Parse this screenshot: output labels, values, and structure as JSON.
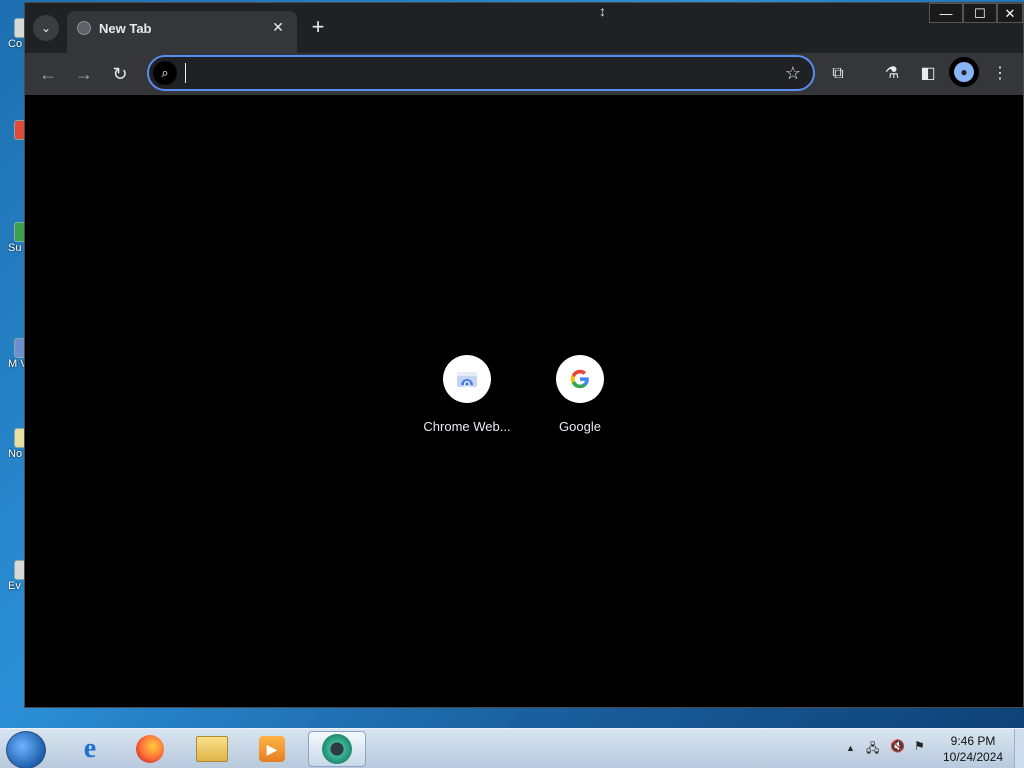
{
  "desktop": {
    "icons": [
      {
        "label": "Co"
      },
      {
        "label": ""
      },
      {
        "label": "Su"
      },
      {
        "label": "M Visu"
      },
      {
        "label": "No"
      },
      {
        "label": "Ev"
      }
    ]
  },
  "browser": {
    "tab": {
      "title": "New Tab",
      "close": "✕"
    },
    "new_tab": "+",
    "tab_search": "⌄",
    "window_controls": {
      "minimize": "—",
      "maximize": "☐",
      "close": "✕"
    },
    "omnibox": {
      "value": "",
      "placeholder": ""
    },
    "shortcuts": [
      {
        "name": "Chrome Web...",
        "icon": "chrome-web-store-icon"
      },
      {
        "name": "Google",
        "icon": "google-g-icon"
      }
    ]
  },
  "taskbar": {
    "apps": [
      {
        "icon": "internet-explorer-icon",
        "glyph": "e"
      },
      {
        "icon": "firefox-icon",
        "glyph": "🦊"
      },
      {
        "icon": "file-explorer-icon",
        "glyph": "📁"
      },
      {
        "icon": "media-player-icon",
        "glyph": "▶"
      },
      {
        "icon": "chrome-dev-icon",
        "glyph": "◉"
      }
    ],
    "tray": {
      "expand": "▲",
      "network": "🖧",
      "volume": "🔇",
      "flag": "⚑"
    },
    "clock": {
      "time": "9:46 PM",
      "date": "10/24/2024"
    }
  },
  "colors": {
    "accent": "#5b8def",
    "toolbar": "#35363a",
    "tabstrip": "#202124",
    "page": "#000000"
  }
}
